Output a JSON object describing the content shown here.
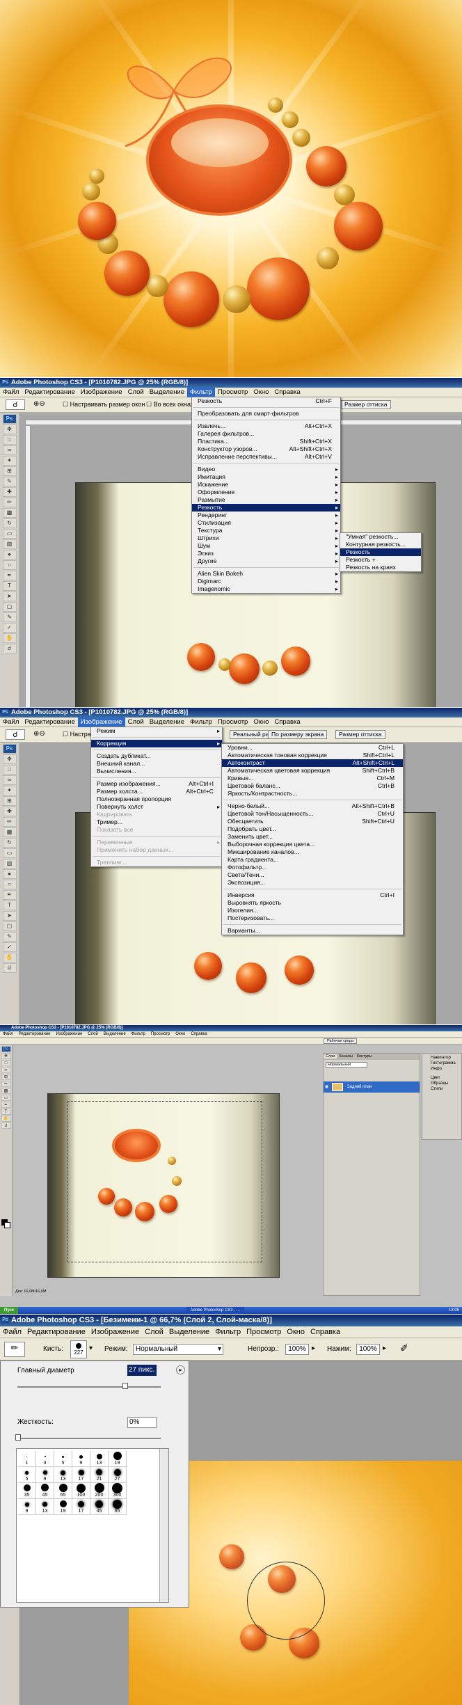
{
  "ps1": {
    "title": "Adobe Photoshop CS3 - [P1010782.JPG @ 25% (RGB/8)]",
    "menu": [
      "Файл",
      "Редактирование",
      "Изображение",
      "Слой",
      "Выделение",
      "Фильтр",
      "Просмотр",
      "Окно",
      "Справка"
    ],
    "options": {
      "fit_label": "Настраивать размер окон",
      "all_windows_label": "Во всех окнах",
      "print_size": "Размер оттиска"
    },
    "filter_menu": [
      {
        "label": "Резкость",
        "shortcut": "Ctrl+F"
      },
      {
        "label": "Преобразовать для смарт-фильтров",
        "shortcut": ""
      },
      {
        "label": "Извлечь...",
        "shortcut": "Alt+Ctrl+X"
      },
      {
        "label": "Галерея фильтров...",
        "shortcut": ""
      },
      {
        "label": "Пластика...",
        "shortcut": "Shift+Ctrl+X"
      },
      {
        "label": "Конструктор узоров...",
        "shortcut": "Alt+Shift+Ctrl+X"
      },
      {
        "label": "Исправление перспективы...",
        "shortcut": "Alt+Ctrl+V"
      },
      {
        "label": "Видео",
        "shortcut": ""
      },
      {
        "label": "Имитация",
        "shortcut": ""
      },
      {
        "label": "Искажение",
        "shortcut": ""
      },
      {
        "label": "Оформление",
        "shortcut": ""
      },
      {
        "label": "Размытие",
        "shortcut": ""
      },
      {
        "label": "Резкость",
        "shortcut": ""
      },
      {
        "label": "Рендеринг",
        "shortcut": ""
      },
      {
        "label": "Стилизация",
        "shortcut": ""
      },
      {
        "label": "Текстура",
        "shortcut": ""
      },
      {
        "label": "Штрихи",
        "shortcut": ""
      },
      {
        "label": "Шум",
        "shortcut": ""
      },
      {
        "label": "Эскиз",
        "shortcut": ""
      },
      {
        "label": "Другие",
        "shortcut": ""
      },
      {
        "label": "Alien Skin Bokeh",
        "shortcut": ""
      },
      {
        "label": "Digimarc",
        "shortcut": ""
      },
      {
        "label": "Imagenomic",
        "shortcut": ""
      }
    ],
    "sharpen_submenu": [
      "\"Умная\" резкость...",
      "Контурная резкость...",
      "Резкость",
      "Резкость +",
      "Резкость на краях"
    ]
  },
  "ps2": {
    "title": "Adobe Photoshop CS3 - [P1010782.JPG @ 25% (RGB/8)]",
    "menu": [
      "Файл",
      "Редактирование",
      "Изображение",
      "Слой",
      "Выделение",
      "Фильтр",
      "Просмотр",
      "Окно",
      "Справка"
    ],
    "options": {
      "actual": "Реальный размер",
      "fit": "По размеру экрана",
      "print": "Размер оттиска",
      "fit_label": "Настраивать размер окон"
    },
    "image_menu": [
      {
        "label": "Режим",
        "shortcut": ""
      },
      {
        "label": "Коррекция",
        "shortcut": ""
      },
      {
        "label": "Создать дубликат...",
        "shortcut": ""
      },
      {
        "label": "Внешний канал...",
        "shortcut": ""
      },
      {
        "label": "Вычисления...",
        "shortcut": ""
      },
      {
        "label": "Размер изображения...",
        "shortcut": "Alt+Ctrl+I"
      },
      {
        "label": "Размер холста...",
        "shortcut": "Alt+Ctrl+C"
      },
      {
        "label": "Полноэкранная пропорция",
        "shortcut": ""
      },
      {
        "label": "Повернуть холст",
        "shortcut": ""
      },
      {
        "label": "Кадрировать",
        "shortcut": ""
      },
      {
        "label": "Тример...",
        "shortcut": ""
      },
      {
        "label": "Показать все",
        "shortcut": ""
      },
      {
        "label": "Переменные",
        "shortcut": ""
      },
      {
        "label": "Применить набор данных...",
        "shortcut": ""
      },
      {
        "label": "Треппинг...",
        "shortcut": ""
      }
    ],
    "adjust_menu": [
      {
        "label": "Уровни...",
        "shortcut": "Ctrl+L"
      },
      {
        "label": "Автоматическая тоновая коррекция",
        "shortcut": "Shift+Ctrl+L"
      },
      {
        "label": "Автоконтраст",
        "shortcut": "Alt+Shift+Ctrl+L"
      },
      {
        "label": "Автоматическая цветовая коррекция",
        "shortcut": "Shift+Ctrl+B"
      },
      {
        "label": "Кривые...",
        "shortcut": "Ctrl+M"
      },
      {
        "label": "Цветовой баланс...",
        "shortcut": "Ctrl+B"
      },
      {
        "label": "Яркость/Контрастность...",
        "shortcut": ""
      },
      {
        "label": "Черно-белый...",
        "shortcut": "Alt+Shift+Ctrl+B"
      },
      {
        "label": "Цветовой тон/Насыщенность...",
        "shortcut": "Ctrl+U"
      },
      {
        "label": "Обесцветить",
        "shortcut": "Shift+Ctrl+U"
      },
      {
        "label": "Подобрать цвет...",
        "shortcut": ""
      },
      {
        "label": "Заменить цвет...",
        "shortcut": ""
      },
      {
        "label": "Выборочная коррекция цвета...",
        "shortcut": ""
      },
      {
        "label": "Микширование каналов...",
        "shortcut": ""
      },
      {
        "label": "Карта градиента...",
        "shortcut": ""
      },
      {
        "label": "Фотофильтр...",
        "shortcut": ""
      },
      {
        "label": "Света/Тени...",
        "shortcut": ""
      },
      {
        "label": "Экспозиция...",
        "shortcut": ""
      },
      {
        "label": "Инверсия",
        "shortcut": "Ctrl+I"
      },
      {
        "label": "Выровнять яркость",
        "shortcut": ""
      },
      {
        "label": "Изогелия...",
        "shortcut": ""
      },
      {
        "label": "Постеризовать...",
        "shortcut": ""
      },
      {
        "label": "Варианты...",
        "shortcut": ""
      }
    ]
  },
  "ps3": {
    "title": "Adobe Photoshop CS3 - [P1010782.JPG @ 25% (RGB/8)]",
    "menu": [
      "Файл",
      "Редактирование",
      "Изображение",
      "Слой",
      "Выделение",
      "Фильтр",
      "Просмотр",
      "Окно",
      "Справка"
    ],
    "workspace": "Рабочая среда",
    "layers_tabs": [
      "Слои",
      "Каналы",
      "Контуры"
    ],
    "layer_mode": "Нормальный",
    "layer_name": "Задний план",
    "side_panels": [
      "Навигатор",
      "Гистограмма",
      "Инфо",
      "Цвет",
      "Образцы",
      "Стили"
    ],
    "status": "Док: 16,0М/16,0М",
    "taskbar": [
      "Пуск",
      "Adobe Photoshop CS3 - ..."
    ],
    "clock": "13:05"
  },
  "ps4": {
    "title": "Adobe Photoshop CS3 - [Безимени-1 @ 66,7% (Слой 2, Слой-маска/8)]",
    "menu": [
      "Файл",
      "Редактирование",
      "Изображение",
      "Слой",
      "Выделение",
      "Фильтр",
      "Просмотр",
      "Окно",
      "Справка"
    ],
    "brush_label": "Кисть:",
    "brush_size": "27",
    "brush_size2": "227",
    "mode_label": "Режим:",
    "mode_value": "Нормальный",
    "opacity_label": "Непрозр.:",
    "opacity_value": "100%",
    "flow_label": "Нажим:",
    "flow_value": "100%",
    "diameter_label": "Главный диаметр",
    "diameter_value": "27 пикс.",
    "hardness_label": "Жесткость:",
    "hardness_value": "0%",
    "presets": [
      "1",
      "3",
      "5",
      "9",
      "13",
      "19",
      "5",
      "9",
      "13",
      "17",
      "21",
      "27",
      "35",
      "45",
      "65",
      "100",
      "200",
      "300",
      "9",
      "13",
      "19",
      "17",
      "45",
      "65"
    ]
  }
}
